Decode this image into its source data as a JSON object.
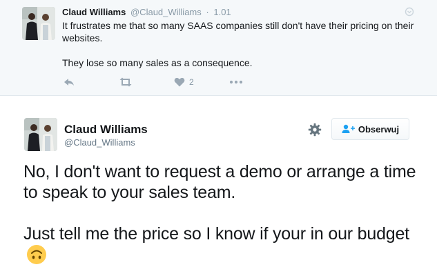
{
  "tweet_top": {
    "author_name": "Claud Williams",
    "handle": "@Claud_Williams",
    "separator": "·",
    "time": "1.01",
    "paragraphs": [
      "It frustrates me that so many SAAS companies still don't have their pricing on their websites.",
      "They lose so many sales as a consequence."
    ],
    "actions": {
      "reply_icon": "reply-icon",
      "retweet_icon": "retweet-icon",
      "like_icon": "heart-icon",
      "like_count": "2",
      "more_icon": "more-dots-icon"
    }
  },
  "tweet_main": {
    "author_name": "Claud Williams",
    "handle": "@Claud_Williams",
    "follow_label": "Obserwuj",
    "paragraph_1": "No, I don't want to request a demo or arrange a time to speak to your sales team.",
    "paragraph_2": "Just tell me the price so I know if your in our budget",
    "emoji": "upside-down-face-emoji"
  },
  "colors": {
    "accent": "#1da1f2",
    "muted": "#8899a6",
    "text": "#14171a",
    "top_background": "#f5f8fa"
  }
}
